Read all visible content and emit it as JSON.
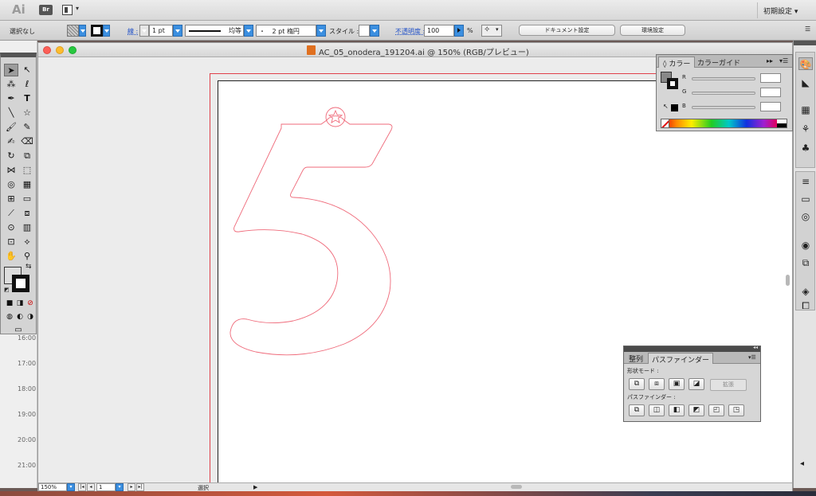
{
  "app": {
    "logo": "Ai",
    "bridge_label": "Br",
    "workspace_label": "初期設定 ▾"
  },
  "control_bar": {
    "selection_label": "選択なし",
    "stroke_link": "線 :",
    "stroke_weight": "1 pt",
    "stroke_profile": "均等",
    "brush_label": "2 pt 楕円",
    "brush_dot": "・",
    "style_label": "スタイル :",
    "opacity_link": "不透明度 :",
    "opacity_value": "100",
    "percent": "%",
    "doc_settings": "ドキュメント設定",
    "prefs": "環境設定"
  },
  "time_labels": [
    "16:00",
    "17:00",
    "18:00",
    "19:00",
    "20:00",
    "21:00"
  ],
  "document": {
    "title": "AC_05_onodera_191204.ai @ 150% (RGB/プレビュー)",
    "zoom": "150%",
    "page": "1",
    "status_text": "選択",
    "status_arrow": "▶"
  },
  "color_panel": {
    "tab_color": "カラー",
    "tab_guide": "カラーガイド",
    "collapse": "▸▸",
    "menu": "▾☰",
    "channels": [
      {
        "label": "R",
        "value": ""
      },
      {
        "label": "G",
        "value": ""
      },
      {
        "label": "B",
        "value": ""
      }
    ]
  },
  "pathfinder": {
    "tab_align": "整列",
    "tab_pathfinder": "パスファインダー",
    "shape_modes_label": "形状モード :",
    "pathfinders_label": "パスファインダー :",
    "expand_label": "拡張",
    "menu": "▾☰",
    "collapse": "◂◂"
  },
  "colors": {
    "bleed": "#e0404a",
    "shape_outline": "#ef6a7a",
    "accent_blue": "#3b8fe0"
  }
}
